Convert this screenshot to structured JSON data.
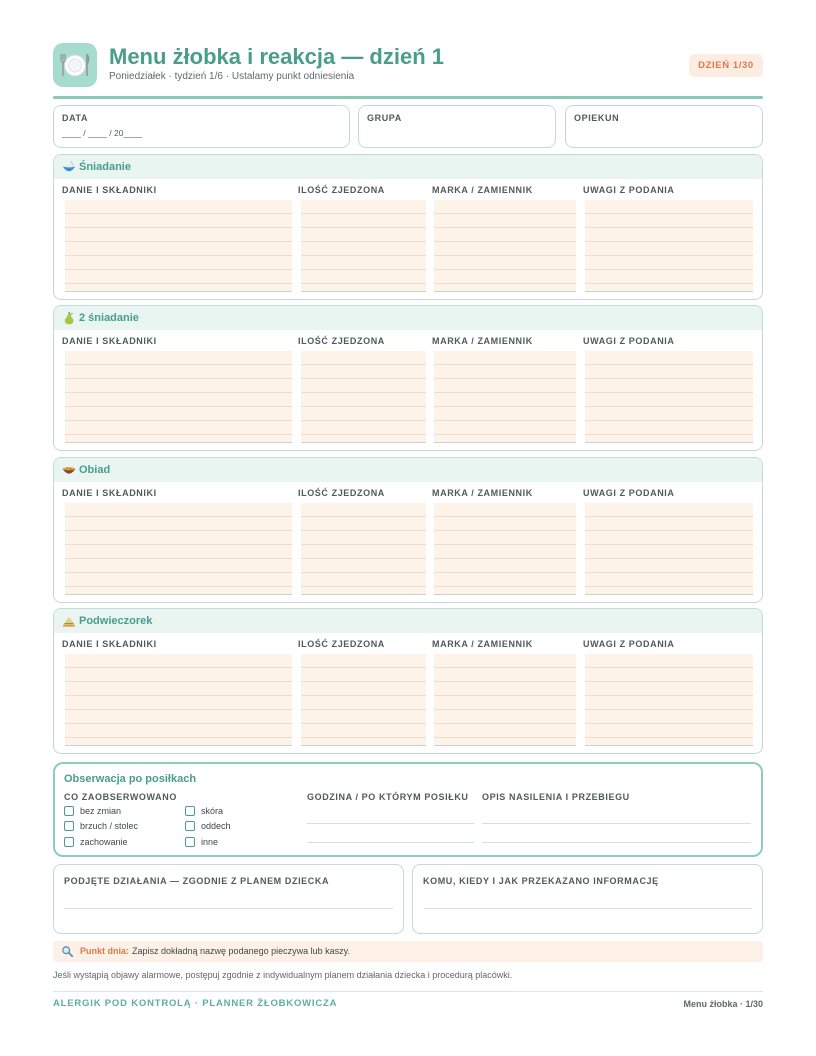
{
  "header": {
    "icon": "plate-cutlery-icon",
    "title": "Menu żłobka i reakcja — dzień 1",
    "subtitle": "Poniedziałek · tydzień 1/6 · Ustalamy punkt odniesienia",
    "badge": "DZIEŃ 1/30"
  },
  "info": {
    "date_label": "DATA",
    "date_value": "____ / ____ / 20____",
    "group_label": "GRUPA",
    "caregiver_label": "OPIEKUN"
  },
  "meal_columns": [
    "DANIE I SKŁADNIKI",
    "ILOŚĆ ZJEDZONA",
    "MARKA / ZAMIENNIK",
    "UWAGI Z PODANIA"
  ],
  "meals": [
    {
      "name": "Śniadanie",
      "icon": "bowl-icon"
    },
    {
      "name": "2 śniadanie",
      "icon": "pear-icon"
    },
    {
      "name": "Obiad",
      "icon": "stew-pot-icon"
    },
    {
      "name": "Podwieczorek",
      "icon": "sandwich-icon"
    }
  ],
  "observation": {
    "title": "Obserwacja po posiłkach",
    "observed_label": "CO ZAOBSERWOWANO",
    "options": [
      {
        "label": "bez zmian"
      },
      {
        "label": "brzuch / stolec"
      },
      {
        "label": "zachowanie"
      },
      {
        "label": "skóra"
      },
      {
        "label": "oddech"
      },
      {
        "label": "inne"
      }
    ],
    "time_label": "GODZINA / PO KTÓRYM POSIŁKU",
    "description_label": "OPIS NASILENIA I PRZEBIEGU"
  },
  "actions": {
    "taken_label": "PODJĘTE DZIAŁANIA — ZGODNIE Z PLANEM DZIECKA",
    "reported_label": "KOMU, KIEDY I JAK PRZEKAZANO INFORMACJĘ"
  },
  "tip": {
    "icon": "magnifier-icon",
    "label": "Punkt dnia:",
    "text": "Zapisz dokładną nazwę podanego pieczywa lub kaszy."
  },
  "note": "Jeśli wystąpią objawy alarmowe, postępuj zgodnie z indywidualnym planem działania dziecka i procedurą placówki.",
  "footer": {
    "brand": "ALERGIK POD KONTROLĄ · PLANNER ŻŁOBKOWICZA",
    "page": "Menu żłobka · 1/30"
  },
  "colors": {
    "accent": "#4a9d8b",
    "accent_light": "#e8f5f1",
    "badge_text": "#e0784a",
    "badge_bg": "#fdece1",
    "writing_area": "#fef3e9"
  }
}
